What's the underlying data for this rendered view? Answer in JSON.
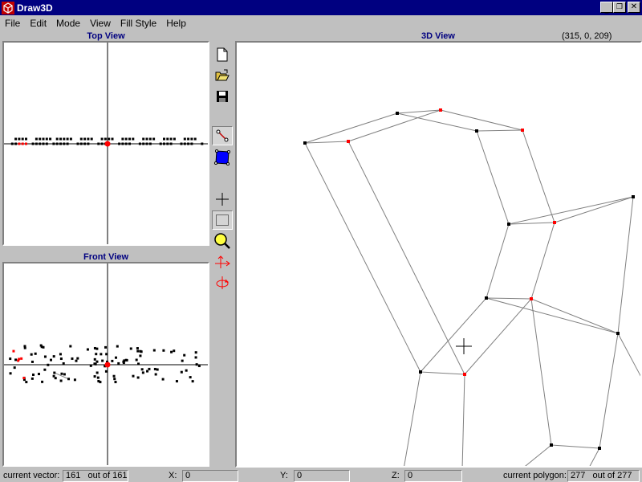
{
  "window": {
    "title": "Draw3D"
  },
  "menu": [
    "File",
    "Edit",
    "Mode",
    "View",
    "Fill Style",
    "Help"
  ],
  "views": {
    "top": "Top View",
    "front": "Front View",
    "three_d": "3D View"
  },
  "cursor_coords": "(315, 0, 209)",
  "status": {
    "vector_label": "current vector:",
    "vector_value": "161",
    "vector_total": "out of 161",
    "x_label": "X:",
    "x_value": "0",
    "y_label": "Y:",
    "y_value": "0",
    "z_label": "Z:",
    "z_value": "0",
    "polygon_label": "current polygon:",
    "polygon_value": "277",
    "polygon_total": "out of 277"
  },
  "toolbar": [
    "new-file-icon",
    "open-folder-icon",
    "save-icon",
    "edge-tool-icon",
    "polygon-tool-icon",
    "crosshair-tool-icon",
    "select-rect-icon",
    "zoom-icon",
    "move-axis-icon",
    "rotate-icon"
  ],
  "colors": {
    "titlebar": "#000080",
    "selected_vertex": "#ff0000",
    "vertex": "#000000",
    "edge": "#808080"
  }
}
